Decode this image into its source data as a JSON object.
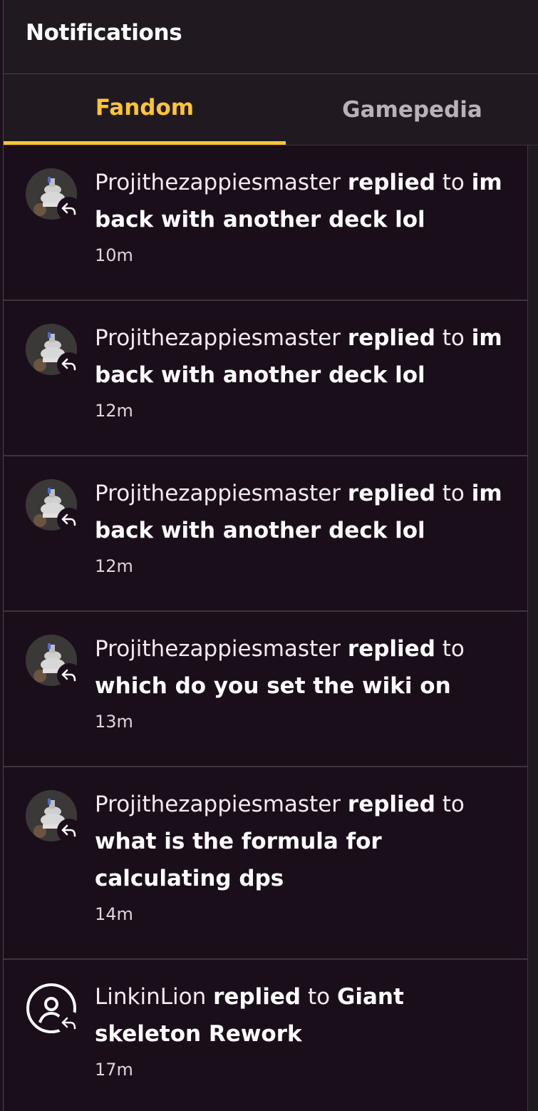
{
  "header": {
    "title": "Notifications"
  },
  "tabs": [
    {
      "label": "Fandom",
      "active": true
    },
    {
      "label": "Gamepedia",
      "active": false
    }
  ],
  "notifications": [
    {
      "user": "Projithezappiesmaster",
      "action": "replied",
      "prep": "to",
      "thread": "im back with another deck lol",
      "time": "10m",
      "avatar": "user-photo"
    },
    {
      "user": "Projithezappiesmaster",
      "action": "replied",
      "prep": "to",
      "thread": "im back with another deck lol",
      "time": "12m",
      "avatar": "user-photo"
    },
    {
      "user": "Projithezappiesmaster",
      "action": "replied",
      "prep": "to",
      "thread": "im back with another deck lol",
      "time": "12m",
      "avatar": "user-photo"
    },
    {
      "user": "Projithezappiesmaster",
      "action": "replied",
      "prep": "to",
      "thread": "which do you set the wiki on",
      "time": "13m",
      "avatar": "user-photo"
    },
    {
      "user": "Projithezappiesmaster",
      "action": "replied",
      "prep": "to",
      "thread": "what is the formula for calculating dps",
      "time": "14m",
      "avatar": "user-photo"
    },
    {
      "user": "LinkinLion",
      "action": "replied",
      "prep": "to",
      "thread": "Giant skeleton Rework",
      "time": "17m",
      "avatar": "default-user-icon"
    }
  ],
  "colors": {
    "accent": "#ffc435",
    "background": "#1b0e1b",
    "header": "#201a20"
  }
}
